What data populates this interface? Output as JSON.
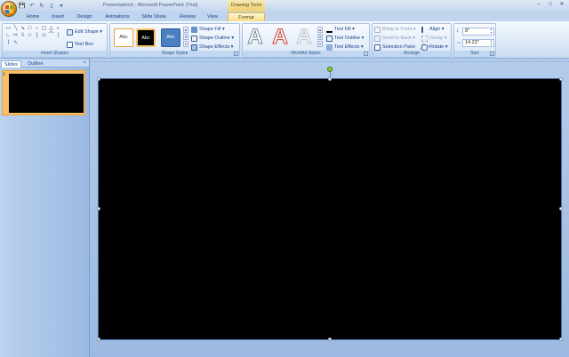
{
  "window": {
    "title": "Presentation2 - Microsoft PowerPoint (Trial)",
    "contextual_tools_label": "Drawing Tools",
    "controls": [
      "–",
      "□",
      "✕"
    ]
  },
  "quick_access": [
    "save",
    "undo",
    "redo",
    "new"
  ],
  "tabs": [
    {
      "label": "Home"
    },
    {
      "label": "Insert"
    },
    {
      "label": "Design"
    },
    {
      "label": "Animations"
    },
    {
      "label": "Slide Show"
    },
    {
      "label": "Review"
    },
    {
      "label": "View"
    },
    {
      "label": "Format"
    }
  ],
  "ribbon": {
    "insert_shapes": {
      "label": "Insert Shapes",
      "edit_shape": "Edit Shape ▾",
      "text_box": "Text Box"
    },
    "shape_styles": {
      "label": "Shape Styles",
      "swatches": [
        "Abc",
        "Abc",
        "Abc"
      ],
      "shape_fill": "Shape Fill ▾",
      "shape_outline": "Shape Outline ▾",
      "shape_effects": "Shape Effects ▾"
    },
    "wordart_styles": {
      "label": "WordArt Styles",
      "letters": [
        "A",
        "A",
        "A"
      ],
      "text_fill": "Text Fill ▾",
      "text_outline": "Text Outline ▾",
      "text_effects": "Text Effects ▾"
    },
    "arrange": {
      "label": "Arrange",
      "bring_to_front": "Bring to Front ▾",
      "send_to_back": "Send to Back ▾",
      "selection_pane": "Selection Pane",
      "align": "Align ▾",
      "group": "Group ▾",
      "rotate": "Rotate ▾"
    },
    "size": {
      "label": "Size",
      "height": "8\"",
      "width": "14.23\""
    }
  },
  "left_panel": {
    "tabs": [
      "Slides",
      "Outline"
    ],
    "close": "×",
    "slide_number": "1"
  },
  "colors": {
    "accent_selected": "#f7c16a",
    "slide_fill": "#000000",
    "ribbon_blue": "#dbe8f7"
  }
}
